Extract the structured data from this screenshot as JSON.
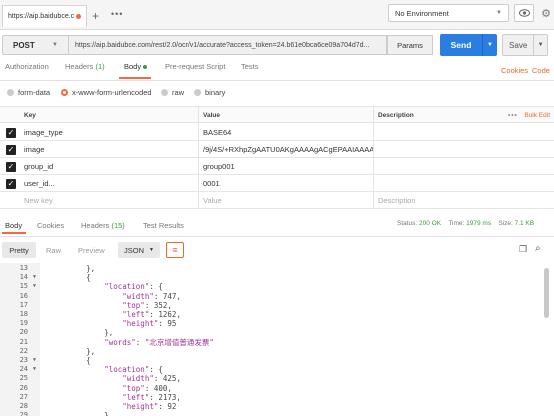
{
  "tabs": [
    {
      "label": "https://aip.baidubce.c"
    }
  ],
  "env": {
    "selected": "No Environment"
  },
  "request": {
    "method": "POST",
    "url": "https://aip.baidubce.com/rest/2.0/ocr/v1/accurate?access_token=24.b61e0bca6ce09a704d7d...",
    "params_label": "Params",
    "send_label": "Send",
    "save_label": "Save"
  },
  "req_tabs": {
    "authorization": "Authorization",
    "headers": "Headers",
    "headers_count": "(1)",
    "body": "Body",
    "prerequest": "Pre-request Script",
    "tests": "Tests",
    "cookies": "Cookies",
    "code": "Code"
  },
  "body_types": {
    "form_data": "form-data",
    "urlencoded": "x-www-form-urlencoded",
    "raw": "raw",
    "binary": "binary",
    "selected": "x-www-form-urlencoded"
  },
  "table": {
    "headers": {
      "key": "Key",
      "value": "Value",
      "description": "Description",
      "more": "•••",
      "bulk_edit": "Bulk Edit"
    },
    "rows": [
      {
        "key": "image_type",
        "value": "BASE64",
        "checked": true
      },
      {
        "key": "image",
        "value": "/9j/4S/+RXhpZgAATU0AKgAAAAgACgEPAAIAAAAG...",
        "checked": true
      },
      {
        "key": "group_id",
        "value": "group001",
        "checked": true
      },
      {
        "key": "user_id...",
        "value": "0001",
        "checked": true
      }
    ],
    "new_row": {
      "key": "New key",
      "value": "Value",
      "description": "Description"
    }
  },
  "response": {
    "tabs": {
      "body": "Body",
      "cookies": "Cookies",
      "headers": "Headers",
      "headers_count": "(15)",
      "tests": "Test Results"
    },
    "status_label": "Status:",
    "status": "200 OK",
    "time_label": "Time:",
    "time": "1979 ms",
    "size_label": "Size:",
    "size": "7.1 KB",
    "view": {
      "pretty": "Pretty",
      "raw": "Raw",
      "preview": "Preview",
      "format": "JSON"
    }
  },
  "code_lines": [
    {
      "n": "13",
      "fold": false,
      "text": "        },"
    },
    {
      "n": "14",
      "fold": true,
      "text": "        {"
    },
    {
      "n": "15",
      "fold": true,
      "text": "            \"location\": {"
    },
    {
      "n": "16",
      "fold": false,
      "text": "                \"width\": 747,"
    },
    {
      "n": "17",
      "fold": false,
      "text": "                \"top\": 352,"
    },
    {
      "n": "18",
      "fold": false,
      "text": "                \"left\": 1262,"
    },
    {
      "n": "19",
      "fold": false,
      "text": "                \"height\": 95"
    },
    {
      "n": "20",
      "fold": false,
      "text": "            },"
    },
    {
      "n": "21",
      "fold": false,
      "text": "            \"words\": \"北京增值普通发票\""
    },
    {
      "n": "22",
      "fold": false,
      "text": "        },"
    },
    {
      "n": "23",
      "fold": true,
      "text": "        {"
    },
    {
      "n": "24",
      "fold": true,
      "text": "            \"location\": {"
    },
    {
      "n": "25",
      "fold": false,
      "text": "                \"width\": 425,"
    },
    {
      "n": "26",
      "fold": false,
      "text": "                \"top\": 400,"
    },
    {
      "n": "27",
      "fold": false,
      "text": "                \"left\": 2173,"
    },
    {
      "n": "28",
      "fold": false,
      "text": "                \"height\": 92"
    },
    {
      "n": "29",
      "fold": false,
      "text": "            },"
    }
  ],
  "colors": {
    "accent": "#f26b3a",
    "send": "#2a7de1",
    "ok": "#3a9c3a",
    "json_string": "#a0339a"
  }
}
